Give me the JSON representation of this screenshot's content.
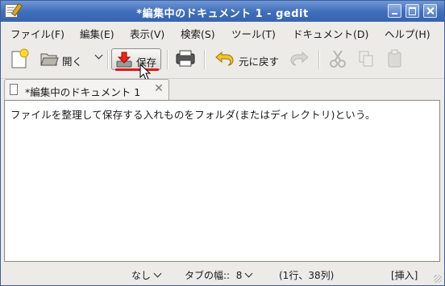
{
  "window": {
    "title": "*編集中のドキュメント 1 - gedit"
  },
  "menu": [
    "ファイル(F)",
    "編集(E)",
    "表示(V)",
    "検索(S)",
    "ツール(T)",
    "ドキュメント(D)",
    "ヘルプ(H)"
  ],
  "toolbar": {
    "open_label": "開く",
    "save_label": "保存",
    "undo_label": "元に戻す"
  },
  "tab": {
    "label": "*編集中のドキュメント 1"
  },
  "editor": {
    "text": "ファイルを整理して保存する入れものをフォルダ(またはディレクトリ)という。"
  },
  "status": {
    "syntax": "なし",
    "tab_width_label": "タブの幅::",
    "tab_width_value": "8",
    "position": "(1行、38列)",
    "mode": "[挿入]"
  },
  "colors": {
    "titlebar": "#3f6db9",
    "highlight_underline": "#e01818"
  }
}
